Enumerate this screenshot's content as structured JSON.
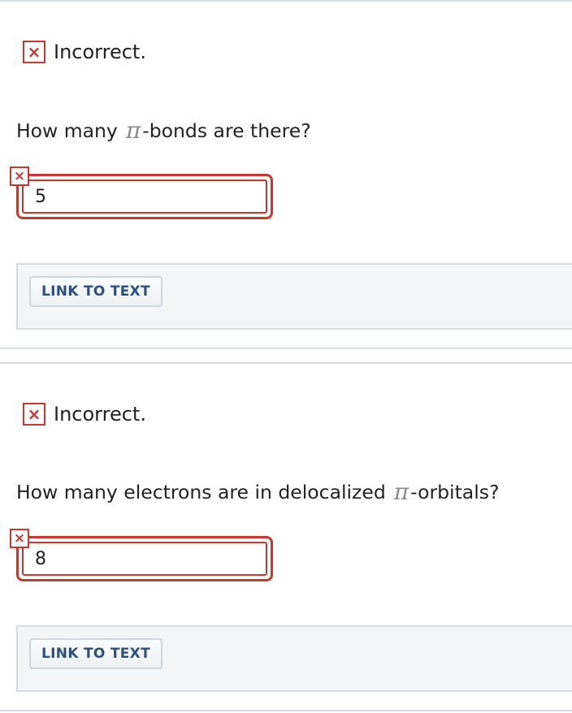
{
  "questions": [
    {
      "status": "Incorrect.",
      "prompt_before": "How many",
      "pi_symbol": "π",
      "prompt_after": "-bonds are there?",
      "answer": "5",
      "link_label": "LINK TO TEXT"
    },
    {
      "status": "Incorrect.",
      "prompt_before": "How many electrons are in delocalized",
      "pi_symbol": "π",
      "prompt_after": "-orbitals?",
      "answer": "8",
      "link_label": "LINK TO TEXT"
    }
  ],
  "icons": {
    "incorrect": "×"
  },
  "colors": {
    "error": "#c6392f",
    "link": "#2b4f85",
    "panel_bg": "#f4f5f6"
  }
}
